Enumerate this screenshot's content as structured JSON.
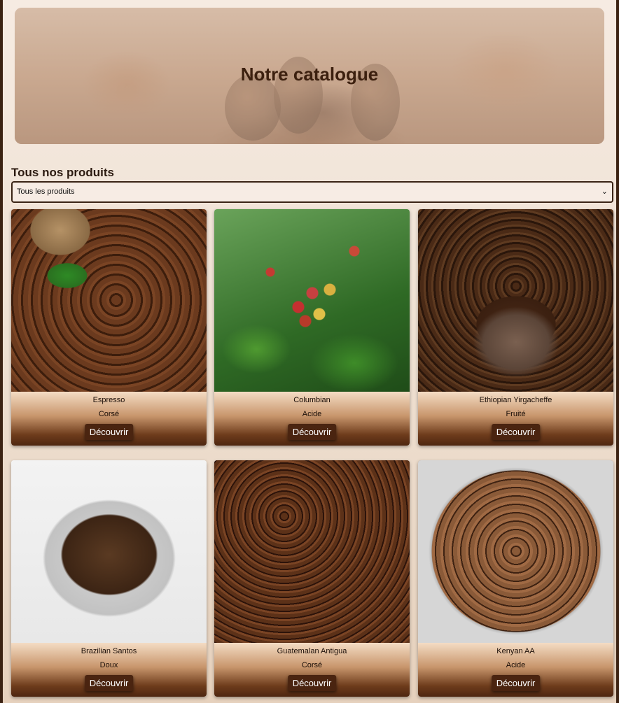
{
  "hero": {
    "title": "Notre catalogue"
  },
  "section": {
    "title": "Tous nos produits"
  },
  "filter": {
    "selected": "Tous les produits"
  },
  "products": [
    {
      "name": "Espresso",
      "taste": "Corsé",
      "button": "Découvrir"
    },
    {
      "name": "Columbian",
      "taste": "Acide",
      "button": "Découvrir"
    },
    {
      "name": "Ethiopian Yirgacheffe",
      "taste": "Fruité",
      "button": "Découvrir"
    },
    {
      "name": "Brazilian Santos",
      "taste": "Doux",
      "button": "Découvrir"
    },
    {
      "name": "Guatemalan Antigua",
      "taste": "Corsé",
      "button": "Découvrir"
    },
    {
      "name": "Kenyan AA",
      "taste": "Acide",
      "button": "Découvrir"
    }
  ],
  "icons": {
    "select": "chevron-down-icon"
  }
}
